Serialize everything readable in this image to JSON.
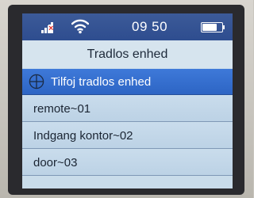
{
  "status_bar": {
    "time": "09 50",
    "icons": [
      "signal-icon",
      "wifi-icon",
      "battery-icon"
    ],
    "signal_alert_color": "#e4332c"
  },
  "screen": {
    "title": "Tradlos enhed",
    "menu": [
      {
        "label": "Tilfoj tradlos enhed",
        "icon": "add-circle-icon",
        "selected": true
      },
      {
        "label": "remote~01",
        "selected": false
      },
      {
        "label": "Indgang kontor~02",
        "selected": false
      },
      {
        "label": "door~03",
        "selected": false
      }
    ]
  },
  "colors": {
    "statusbar": "#2e4d8f",
    "selection": "#2d65c4",
    "list_background": "#c9dcec"
  }
}
